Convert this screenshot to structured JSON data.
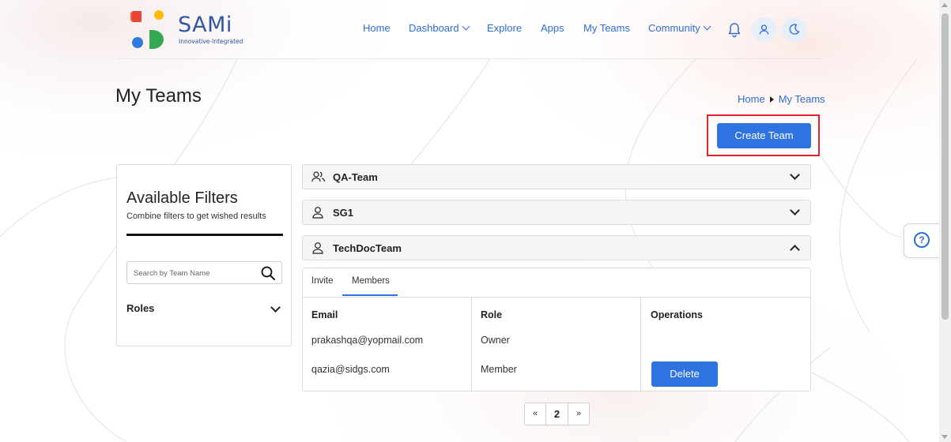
{
  "brand": {
    "name": "SAMi",
    "tagline": "Innovative-Integrated",
    "colors": {
      "orange": "#f06a30",
      "red": "#ea4335",
      "blue": "#2f7be0",
      "green": "#34a853",
      "yellow": "#fbbc05"
    }
  },
  "nav": {
    "items": [
      {
        "label": "Home"
      },
      {
        "label": "Dashboard",
        "dropdown": true
      },
      {
        "label": "Explore"
      },
      {
        "label": "Apps"
      },
      {
        "label": "My Teams"
      },
      {
        "label": "Community",
        "dropdown": true
      }
    ],
    "icons": [
      "bell-icon",
      "user-icon",
      "moon-icon"
    ]
  },
  "page": {
    "title": "My Teams",
    "breadcrumb": {
      "home": "Home",
      "current": "My Teams"
    },
    "create_button": "Create Team"
  },
  "filters": {
    "title": "Available Filters",
    "subtitle": "Combine filters to get wished results",
    "search_placeholder": "Search by Team Name",
    "roles_label": "Roles"
  },
  "teams": [
    {
      "name": "QA-Team",
      "icon": "users-icon",
      "expanded": false
    },
    {
      "name": "SG1",
      "icon": "user-icon",
      "expanded": false
    },
    {
      "name": "TechDocTeam",
      "icon": "user-icon",
      "expanded": true
    }
  ],
  "team_detail": {
    "tabs": [
      {
        "label": "Invite",
        "active": false
      },
      {
        "label": "Members",
        "active": true
      }
    ],
    "columns": [
      "Email",
      "Role",
      "Operations"
    ],
    "members": [
      {
        "email": "prakashqa@yopmail.com",
        "role": "Owner",
        "operation": ""
      },
      {
        "email": "qazia@sidgs.com",
        "role": "Member",
        "operation": "Delete"
      }
    ]
  },
  "pagination": {
    "prev": "«",
    "page": "2",
    "next": "»"
  },
  "accent_color": "#2f73e0",
  "highlight_color": "#e0242b"
}
